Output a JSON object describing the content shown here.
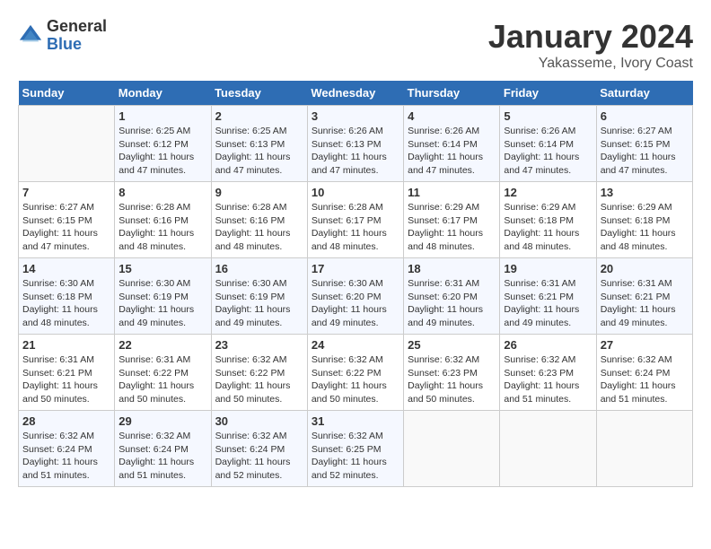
{
  "header": {
    "logo_general": "General",
    "logo_blue": "Blue",
    "month_title": "January 2024",
    "location": "Yakasseme, Ivory Coast"
  },
  "weekdays": [
    "Sunday",
    "Monday",
    "Tuesday",
    "Wednesday",
    "Thursday",
    "Friday",
    "Saturday"
  ],
  "weeks": [
    [
      {
        "day": "",
        "info": ""
      },
      {
        "day": "1",
        "info": "Sunrise: 6:25 AM\nSunset: 6:12 PM\nDaylight: 11 hours and 47 minutes."
      },
      {
        "day": "2",
        "info": "Sunrise: 6:25 AM\nSunset: 6:13 PM\nDaylight: 11 hours and 47 minutes."
      },
      {
        "day": "3",
        "info": "Sunrise: 6:26 AM\nSunset: 6:13 PM\nDaylight: 11 hours and 47 minutes."
      },
      {
        "day": "4",
        "info": "Sunrise: 6:26 AM\nSunset: 6:14 PM\nDaylight: 11 hours and 47 minutes."
      },
      {
        "day": "5",
        "info": "Sunrise: 6:26 AM\nSunset: 6:14 PM\nDaylight: 11 hours and 47 minutes."
      },
      {
        "day": "6",
        "info": "Sunrise: 6:27 AM\nSunset: 6:15 PM\nDaylight: 11 hours and 47 minutes."
      }
    ],
    [
      {
        "day": "7",
        "info": "Sunrise: 6:27 AM\nSunset: 6:15 PM\nDaylight: 11 hours and 47 minutes."
      },
      {
        "day": "8",
        "info": "Sunrise: 6:28 AM\nSunset: 6:16 PM\nDaylight: 11 hours and 48 minutes."
      },
      {
        "day": "9",
        "info": "Sunrise: 6:28 AM\nSunset: 6:16 PM\nDaylight: 11 hours and 48 minutes."
      },
      {
        "day": "10",
        "info": "Sunrise: 6:28 AM\nSunset: 6:17 PM\nDaylight: 11 hours and 48 minutes."
      },
      {
        "day": "11",
        "info": "Sunrise: 6:29 AM\nSunset: 6:17 PM\nDaylight: 11 hours and 48 minutes."
      },
      {
        "day": "12",
        "info": "Sunrise: 6:29 AM\nSunset: 6:18 PM\nDaylight: 11 hours and 48 minutes."
      },
      {
        "day": "13",
        "info": "Sunrise: 6:29 AM\nSunset: 6:18 PM\nDaylight: 11 hours and 48 minutes."
      }
    ],
    [
      {
        "day": "14",
        "info": "Sunrise: 6:30 AM\nSunset: 6:18 PM\nDaylight: 11 hours and 48 minutes."
      },
      {
        "day": "15",
        "info": "Sunrise: 6:30 AM\nSunset: 6:19 PM\nDaylight: 11 hours and 49 minutes."
      },
      {
        "day": "16",
        "info": "Sunrise: 6:30 AM\nSunset: 6:19 PM\nDaylight: 11 hours and 49 minutes."
      },
      {
        "day": "17",
        "info": "Sunrise: 6:30 AM\nSunset: 6:20 PM\nDaylight: 11 hours and 49 minutes."
      },
      {
        "day": "18",
        "info": "Sunrise: 6:31 AM\nSunset: 6:20 PM\nDaylight: 11 hours and 49 minutes."
      },
      {
        "day": "19",
        "info": "Sunrise: 6:31 AM\nSunset: 6:21 PM\nDaylight: 11 hours and 49 minutes."
      },
      {
        "day": "20",
        "info": "Sunrise: 6:31 AM\nSunset: 6:21 PM\nDaylight: 11 hours and 49 minutes."
      }
    ],
    [
      {
        "day": "21",
        "info": "Sunrise: 6:31 AM\nSunset: 6:21 PM\nDaylight: 11 hours and 50 minutes."
      },
      {
        "day": "22",
        "info": "Sunrise: 6:31 AM\nSunset: 6:22 PM\nDaylight: 11 hours and 50 minutes."
      },
      {
        "day": "23",
        "info": "Sunrise: 6:32 AM\nSunset: 6:22 PM\nDaylight: 11 hours and 50 minutes."
      },
      {
        "day": "24",
        "info": "Sunrise: 6:32 AM\nSunset: 6:22 PM\nDaylight: 11 hours and 50 minutes."
      },
      {
        "day": "25",
        "info": "Sunrise: 6:32 AM\nSunset: 6:23 PM\nDaylight: 11 hours and 50 minutes."
      },
      {
        "day": "26",
        "info": "Sunrise: 6:32 AM\nSunset: 6:23 PM\nDaylight: 11 hours and 51 minutes."
      },
      {
        "day": "27",
        "info": "Sunrise: 6:32 AM\nSunset: 6:24 PM\nDaylight: 11 hours and 51 minutes."
      }
    ],
    [
      {
        "day": "28",
        "info": "Sunrise: 6:32 AM\nSunset: 6:24 PM\nDaylight: 11 hours and 51 minutes."
      },
      {
        "day": "29",
        "info": "Sunrise: 6:32 AM\nSunset: 6:24 PM\nDaylight: 11 hours and 51 minutes."
      },
      {
        "day": "30",
        "info": "Sunrise: 6:32 AM\nSunset: 6:24 PM\nDaylight: 11 hours and 52 minutes."
      },
      {
        "day": "31",
        "info": "Sunrise: 6:32 AM\nSunset: 6:25 PM\nDaylight: 11 hours and 52 minutes."
      },
      {
        "day": "",
        "info": ""
      },
      {
        "day": "",
        "info": ""
      },
      {
        "day": "",
        "info": ""
      }
    ]
  ]
}
